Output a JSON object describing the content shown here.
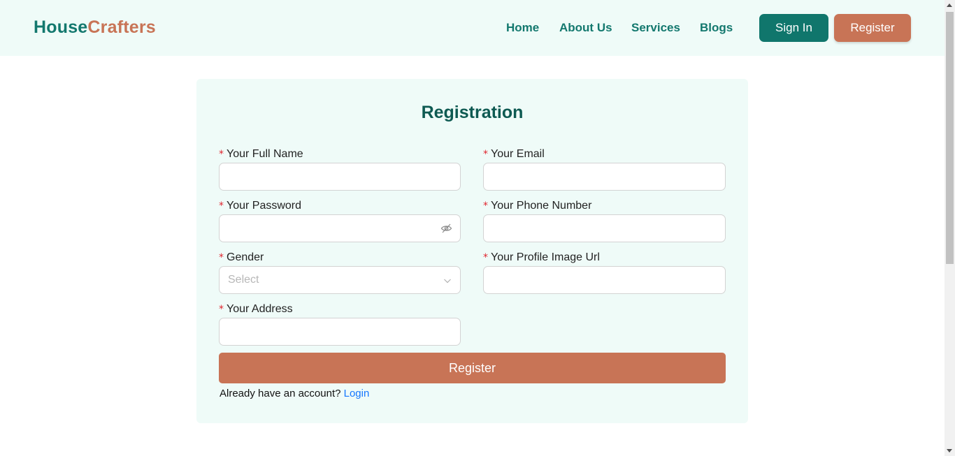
{
  "header": {
    "logo_part1": "House",
    "logo_part2": "Crafters",
    "nav": [
      "Home",
      "About Us",
      "Services",
      "Blogs"
    ],
    "signin_label": "Sign In",
    "register_label": "Register"
  },
  "form": {
    "title": "Registration",
    "required_mark": "*",
    "fields": {
      "full_name": {
        "label": "Your Full Name",
        "value": ""
      },
      "email": {
        "label": "Your Email",
        "value": ""
      },
      "password": {
        "label": "Your Password",
        "value": ""
      },
      "phone": {
        "label": "Your Phone Number",
        "value": ""
      },
      "gender": {
        "label": "Gender",
        "placeholder": "Select"
      },
      "profile_image": {
        "label": "Your Profile Image Url",
        "value": ""
      },
      "address": {
        "label": "Your Address",
        "value": ""
      }
    },
    "submit_label": "Register",
    "footer_text": "Already have an account?",
    "login_link": "Login"
  },
  "icons": {
    "password_toggle": "eye-invisible-icon",
    "select_arrow": "chevron-down-icon"
  },
  "colors": {
    "brand_teal": "#13786e",
    "brand_orange": "#c87456",
    "background_tint": "#effbf8",
    "required": "#e0262f",
    "link": "#1677ff"
  }
}
